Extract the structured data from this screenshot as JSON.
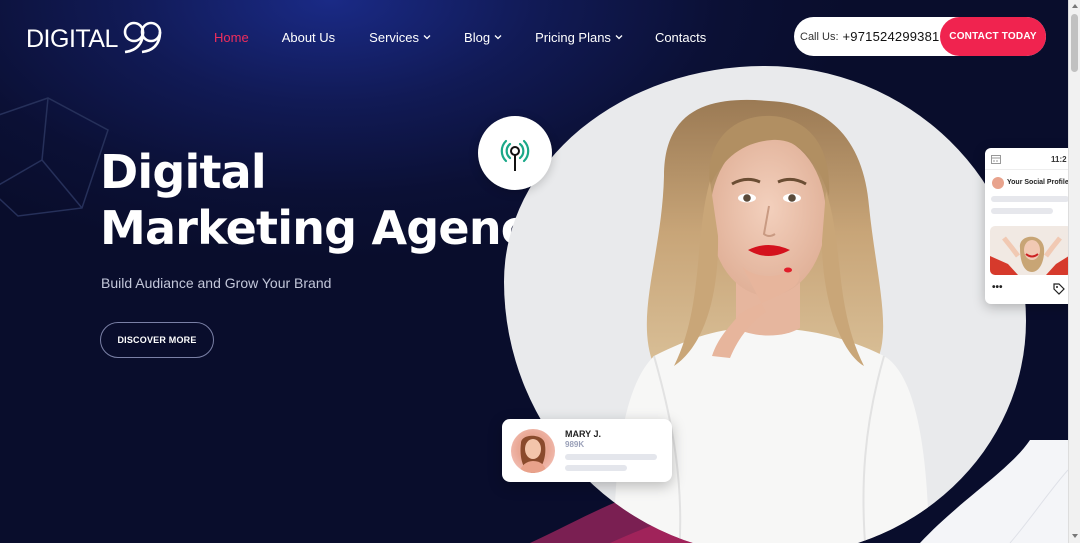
{
  "brand": {
    "logo_text": "DIGITAL99",
    "accent_color": "#f0234f",
    "bg_color": "#0c1236"
  },
  "nav": {
    "items": [
      {
        "label": "Home",
        "active": true,
        "has_dropdown": false
      },
      {
        "label": "About Us",
        "active": false,
        "has_dropdown": false
      },
      {
        "label": "Services",
        "active": false,
        "has_dropdown": true
      },
      {
        "label": "Blog",
        "active": false,
        "has_dropdown": true
      },
      {
        "label": "Pricing Plans",
        "active": false,
        "has_dropdown": true
      },
      {
        "label": "Contacts",
        "active": false,
        "has_dropdown": false
      }
    ]
  },
  "header": {
    "call_label": "Call Us:",
    "call_number": "+971524299381",
    "contact_button": "CONTACT TODAY"
  },
  "hero": {
    "title_line1": "Digital",
    "title_line2": "Marketing Agency",
    "subtitle": "Build Audiance and Grow Your Brand",
    "cta": "DISCOVER MORE"
  },
  "profile_card": {
    "name": "MARY J.",
    "followers": "989K"
  },
  "social_card": {
    "time": "11:2",
    "title": "Your Social Profile",
    "more": "•••",
    "tag_icon": "tag-icon"
  },
  "icons": {
    "signal": "signal-tower-icon",
    "chevron": "chevron-down-icon",
    "calendar": "calendar-icon"
  }
}
